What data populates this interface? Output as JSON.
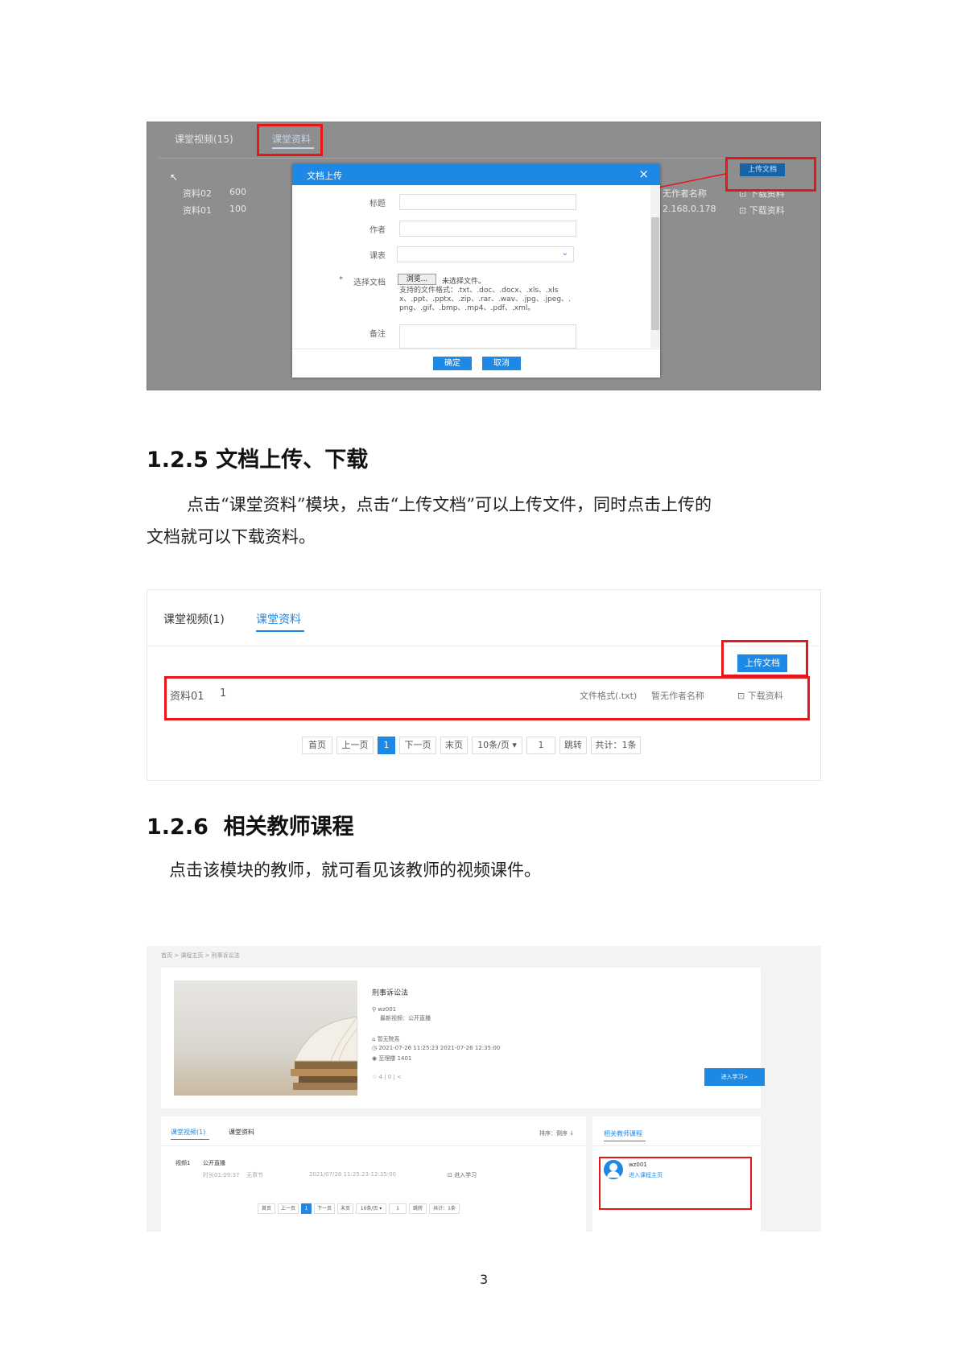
{
  "screenshot1": {
    "tabs": [
      "课堂视频(15)",
      "课堂资料"
    ],
    "rows": [
      {
        "name": "资料02",
        "value": "600",
        "author": "无作者名称",
        "action": "下载资料"
      },
      {
        "name": "资料01",
        "value": "100",
        "author": "2.168.0.178",
        "action": "下载资料"
      }
    ],
    "upload_button": "上传文档",
    "dialog": {
      "title": "文档上传",
      "close": "×",
      "labels": {
        "title": "标题",
        "author": "作者",
        "course": "课表",
        "file": "选择文档",
        "note": "备注"
      },
      "required_mark": "*",
      "browse": "浏览...",
      "no_file": "未选择文件。",
      "formats_line1": "支持的文件格式：.txt、.doc、.docx、.xls、.xls",
      "formats_line2": "x、.ppt、.pptx、.zip、.rar、.wav、.jpg、.jpeg、.",
      "formats_line3": "png、.gif、.bmp、.mp4、.pdf、.xml。",
      "confirm": "确定",
      "cancel": "取消"
    }
  },
  "section1": {
    "heading_num": "1.2.5",
    "heading_text": "文档上传、下载",
    "para_line1": "点击“课堂资料”模块，点击“上传文档”可以上传文件，同时点击上传的",
    "para_line2": "文档就可以下载资料。"
  },
  "screenshot2": {
    "tabs": [
      "课堂视频(1)",
      "课堂资料"
    ],
    "upload_button": "上传文档",
    "row": {
      "name": "资料01",
      "count": "1",
      "format": "文件格式(.txt)",
      "author": "暂无作者名称",
      "action": "下载资料"
    },
    "pager": [
      "首页",
      "上一页",
      "1",
      "下一页",
      "末页",
      "10条/页 ▾",
      "1",
      "跳转",
      "共计：1条"
    ]
  },
  "section2": {
    "heading_num": "1.2.6",
    "heading_text": "相关教师课程",
    "para": "点击该模块的教师，就可看见该教师的视频课件。"
  },
  "screenshot3": {
    "breadcrumb": "首页 > 课程主页 > 刑事诉讼法",
    "course_title": "刑事诉讼法",
    "teacher": "wz001",
    "latest": "最新视频：公开直播",
    "dept": "暂无院系",
    "time": "2021-07-26 11:25:23    2021-07-26 12:35:00",
    "room": "至理楼  1401",
    "stats": "4  |  0  |",
    "enter_button": "进入学习>",
    "tabs": [
      "课堂视频(1)",
      "课堂资料"
    ],
    "sort": "排序：倒序 ↓",
    "video_name": "视频1",
    "video_tag": "公开直播",
    "duration": "时长01:09:37",
    "chapter": "无章节",
    "video_time": "2021/07/26 11:25:23-12:35:00",
    "video_action": "进入学习",
    "pager": [
      "首页",
      "上一页",
      "1",
      "下一页",
      "末页",
      "10条/页 ▾",
      "1",
      "跳转",
      "共计：1条"
    ],
    "related_title": "相关教师课程",
    "related_teacher": "wz001",
    "related_link": "进入课程主页"
  },
  "page_number": "3",
  "colors": {
    "accent": "#1e88e5",
    "highlight_red": "#e6161b"
  }
}
